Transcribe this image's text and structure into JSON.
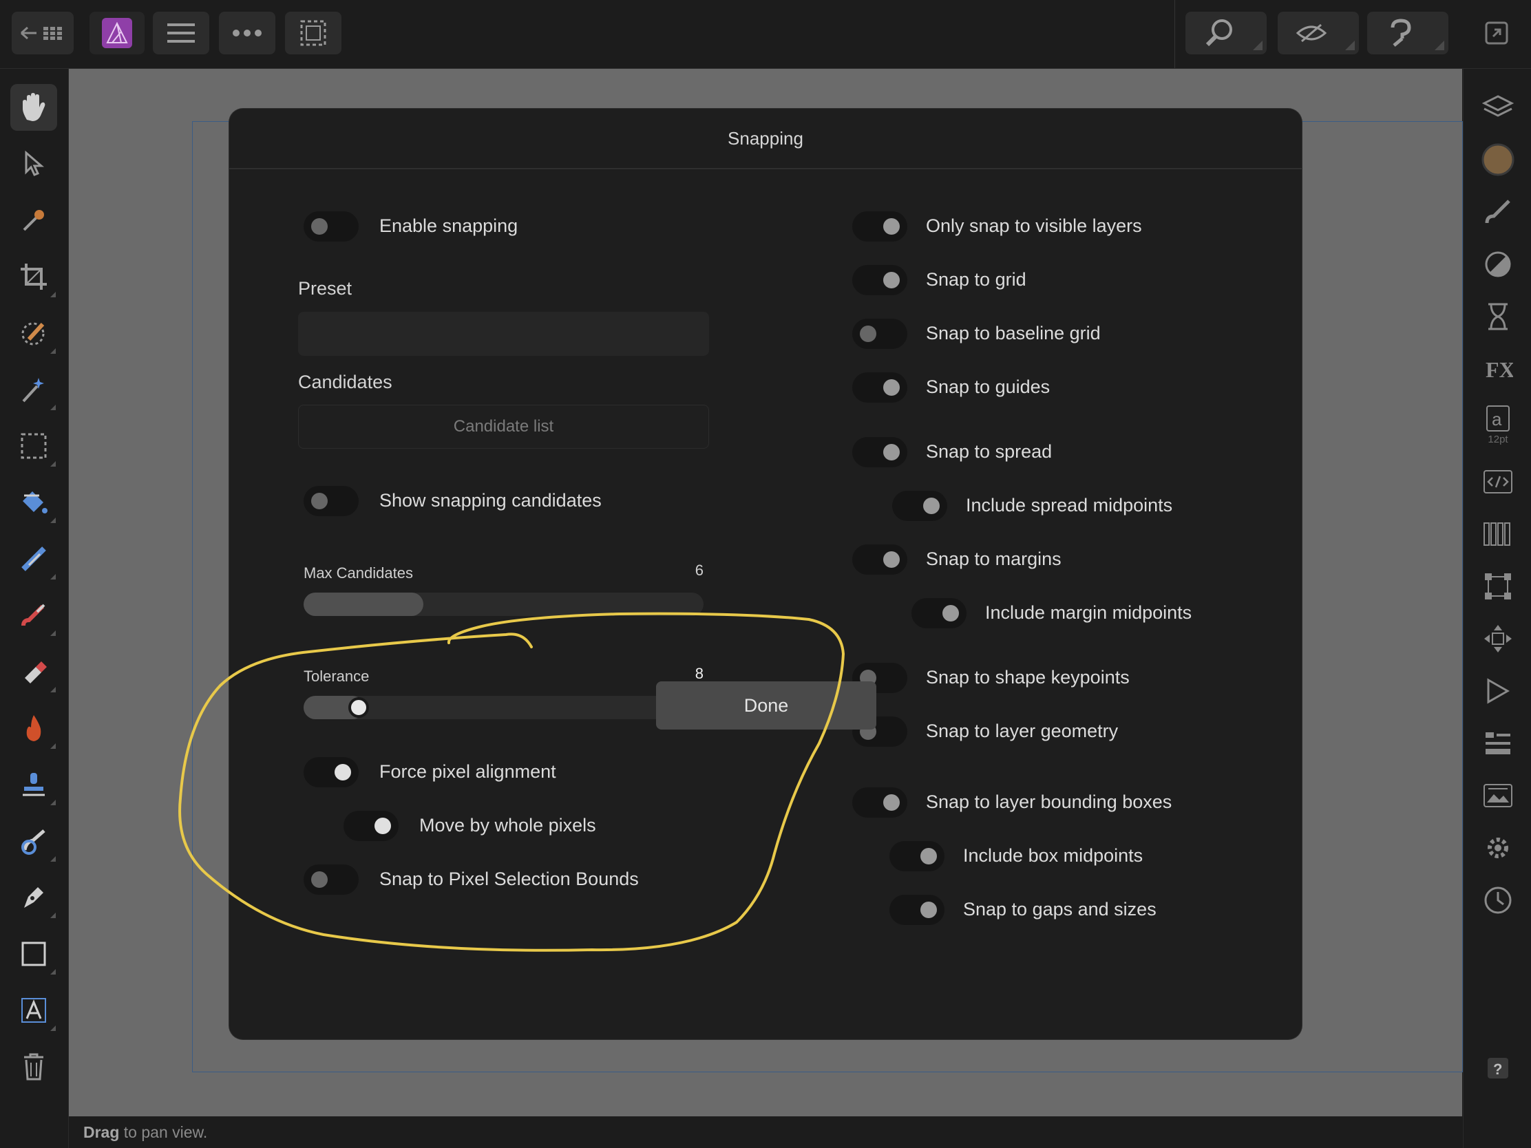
{
  "dialog": {
    "title": "Snapping",
    "done_label": "Done",
    "left": {
      "enable_snapping": {
        "label": "Enable snapping",
        "on": false
      },
      "preset_label": "Preset",
      "preset_value": "",
      "candidates_label": "Candidates",
      "candidate_list_label": "Candidate list",
      "show_candidates": {
        "label": "Show snapping candidates",
        "on": false
      },
      "max_candidates": {
        "label": "Max Candidates",
        "value": "6",
        "fraction": 0.3
      },
      "tolerance": {
        "label": "Tolerance",
        "value": "8",
        "fraction": 0.13
      },
      "force_pixel_alignment": {
        "label": "Force pixel alignment",
        "on": true
      },
      "move_whole_pixels": {
        "label": "Move by whole pixels",
        "on": true
      },
      "pixel_selection_bounds": {
        "label": "Snap to Pixel Selection Bounds",
        "on": false
      }
    },
    "right": [
      {
        "label": "Only snap to visible layers",
        "on": true
      },
      {
        "label": "Snap to grid",
        "on": true
      },
      {
        "label": "Snap to baseline grid",
        "on": false
      },
      {
        "label": "Snap to guides",
        "on": true
      },
      {
        "label": "Snap to spread",
        "on": true
      },
      {
        "label": "Include spread midpoints",
        "on": true
      },
      {
        "label": "Snap to margins",
        "on": true
      },
      {
        "label": "Include margin midpoints",
        "on": true
      },
      {
        "label": "Snap to shape keypoints",
        "on": false
      },
      {
        "label": "Snap to layer geometry",
        "on": false
      },
      {
        "label": "Snap to layer bounding boxes",
        "on": true
      },
      {
        "label": "Include box midpoints",
        "on": true
      },
      {
        "label": "Snap to gaps and sizes",
        "on": true
      }
    ]
  },
  "status": {
    "bold": "Drag",
    "rest": " to pan view."
  },
  "right_rail": {
    "font_size_badge": "12pt"
  },
  "colors": {
    "accent_swatch": "#7a6040",
    "scribble": "#e8c94a",
    "app_icon": "#8f3fa8"
  },
  "icons": {
    "top_left": [
      "back-arrow-icon",
      "grid-icon",
      "app-icon",
      "hamburger-icon",
      "more-icon",
      "selection-icon"
    ],
    "top_right": [
      "zoom-icon",
      "view-mode-icon",
      "assistant-icon",
      "fullscreen-icon"
    ]
  }
}
